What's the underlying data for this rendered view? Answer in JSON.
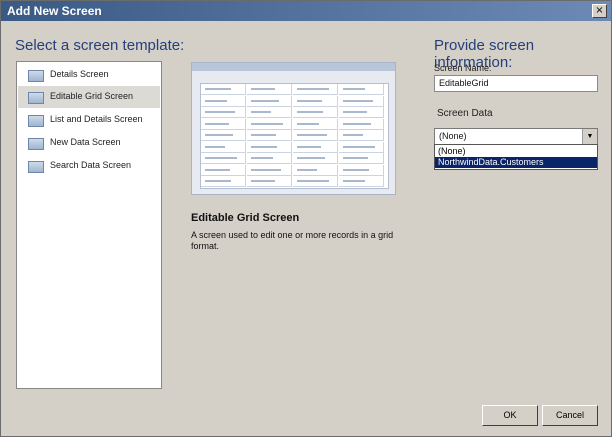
{
  "window": {
    "title": "Add New Screen",
    "close_glyph": "×"
  },
  "left": {
    "heading": "Select a screen template:",
    "templates": [
      {
        "label": "Details Screen",
        "icon": "details-screen-icon"
      },
      {
        "label": "Editable Grid Screen",
        "icon": "grid-screen-icon",
        "selected": true
      },
      {
        "label": "List and Details Screen",
        "icon": "list-details-icon"
      },
      {
        "label": "New Data Screen",
        "icon": "new-data-icon"
      },
      {
        "label": "Search Data Screen",
        "icon": "search-data-icon"
      }
    ]
  },
  "preview": {
    "title": "Editable Grid Screen",
    "description": "A screen used to edit one or more records in a grid format."
  },
  "right": {
    "heading": "Provide screen information:",
    "screen_name_label": "Screen Name:",
    "screen_name_value": "EditableGrid",
    "screen_data_label": "Screen Data",
    "screen_data_value": "(None)",
    "options": [
      "(None)",
      "NorthwindData.Customers"
    ]
  },
  "buttons": {
    "ok": "OK",
    "cancel": "Cancel"
  }
}
